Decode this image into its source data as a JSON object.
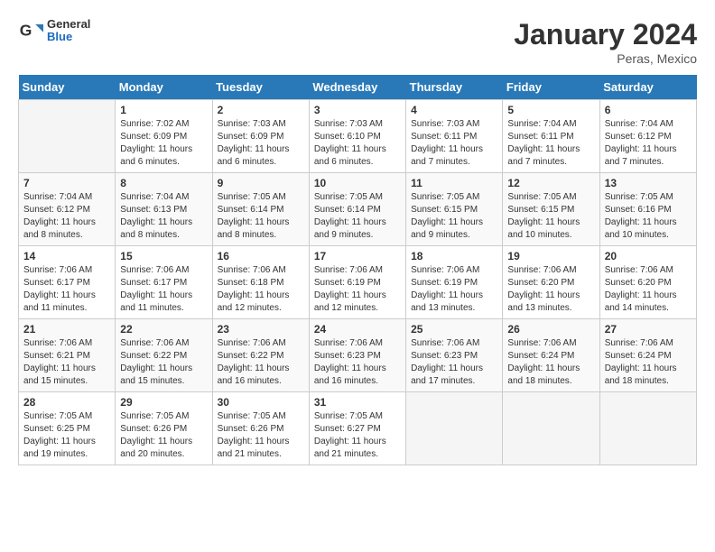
{
  "header": {
    "logo": {
      "general": "General",
      "blue": "Blue"
    },
    "title": "January 2024",
    "location": "Peras, Mexico"
  },
  "weekdays": [
    "Sunday",
    "Monday",
    "Tuesday",
    "Wednesday",
    "Thursday",
    "Friday",
    "Saturday"
  ],
  "weeks": [
    [
      {
        "day": "",
        "empty": true
      },
      {
        "day": "1",
        "sunrise": "Sunrise: 7:02 AM",
        "sunset": "Sunset: 6:09 PM",
        "daylight": "Daylight: 11 hours and 6 minutes."
      },
      {
        "day": "2",
        "sunrise": "Sunrise: 7:03 AM",
        "sunset": "Sunset: 6:09 PM",
        "daylight": "Daylight: 11 hours and 6 minutes."
      },
      {
        "day": "3",
        "sunrise": "Sunrise: 7:03 AM",
        "sunset": "Sunset: 6:10 PM",
        "daylight": "Daylight: 11 hours and 6 minutes."
      },
      {
        "day": "4",
        "sunrise": "Sunrise: 7:03 AM",
        "sunset": "Sunset: 6:11 PM",
        "daylight": "Daylight: 11 hours and 7 minutes."
      },
      {
        "day": "5",
        "sunrise": "Sunrise: 7:04 AM",
        "sunset": "Sunset: 6:11 PM",
        "daylight": "Daylight: 11 hours and 7 minutes."
      },
      {
        "day": "6",
        "sunrise": "Sunrise: 7:04 AM",
        "sunset": "Sunset: 6:12 PM",
        "daylight": "Daylight: 11 hours and 7 minutes."
      }
    ],
    [
      {
        "day": "7",
        "sunrise": "Sunrise: 7:04 AM",
        "sunset": "Sunset: 6:12 PM",
        "daylight": "Daylight: 11 hours and 8 minutes."
      },
      {
        "day": "8",
        "sunrise": "Sunrise: 7:04 AM",
        "sunset": "Sunset: 6:13 PM",
        "daylight": "Daylight: 11 hours and 8 minutes."
      },
      {
        "day": "9",
        "sunrise": "Sunrise: 7:05 AM",
        "sunset": "Sunset: 6:14 PM",
        "daylight": "Daylight: 11 hours and 8 minutes."
      },
      {
        "day": "10",
        "sunrise": "Sunrise: 7:05 AM",
        "sunset": "Sunset: 6:14 PM",
        "daylight": "Daylight: 11 hours and 9 minutes."
      },
      {
        "day": "11",
        "sunrise": "Sunrise: 7:05 AM",
        "sunset": "Sunset: 6:15 PM",
        "daylight": "Daylight: 11 hours and 9 minutes."
      },
      {
        "day": "12",
        "sunrise": "Sunrise: 7:05 AM",
        "sunset": "Sunset: 6:15 PM",
        "daylight": "Daylight: 11 hours and 10 minutes."
      },
      {
        "day": "13",
        "sunrise": "Sunrise: 7:05 AM",
        "sunset": "Sunset: 6:16 PM",
        "daylight": "Daylight: 11 hours and 10 minutes."
      }
    ],
    [
      {
        "day": "14",
        "sunrise": "Sunrise: 7:06 AM",
        "sunset": "Sunset: 6:17 PM",
        "daylight": "Daylight: 11 hours and 11 minutes."
      },
      {
        "day": "15",
        "sunrise": "Sunrise: 7:06 AM",
        "sunset": "Sunset: 6:17 PM",
        "daylight": "Daylight: 11 hours and 11 minutes."
      },
      {
        "day": "16",
        "sunrise": "Sunrise: 7:06 AM",
        "sunset": "Sunset: 6:18 PM",
        "daylight": "Daylight: 11 hours and 12 minutes."
      },
      {
        "day": "17",
        "sunrise": "Sunrise: 7:06 AM",
        "sunset": "Sunset: 6:19 PM",
        "daylight": "Daylight: 11 hours and 12 minutes."
      },
      {
        "day": "18",
        "sunrise": "Sunrise: 7:06 AM",
        "sunset": "Sunset: 6:19 PM",
        "daylight": "Daylight: 11 hours and 13 minutes."
      },
      {
        "day": "19",
        "sunrise": "Sunrise: 7:06 AM",
        "sunset": "Sunset: 6:20 PM",
        "daylight": "Daylight: 11 hours and 13 minutes."
      },
      {
        "day": "20",
        "sunrise": "Sunrise: 7:06 AM",
        "sunset": "Sunset: 6:20 PM",
        "daylight": "Daylight: 11 hours and 14 minutes."
      }
    ],
    [
      {
        "day": "21",
        "sunrise": "Sunrise: 7:06 AM",
        "sunset": "Sunset: 6:21 PM",
        "daylight": "Daylight: 11 hours and 15 minutes."
      },
      {
        "day": "22",
        "sunrise": "Sunrise: 7:06 AM",
        "sunset": "Sunset: 6:22 PM",
        "daylight": "Daylight: 11 hours and 15 minutes."
      },
      {
        "day": "23",
        "sunrise": "Sunrise: 7:06 AM",
        "sunset": "Sunset: 6:22 PM",
        "daylight": "Daylight: 11 hours and 16 minutes."
      },
      {
        "day": "24",
        "sunrise": "Sunrise: 7:06 AM",
        "sunset": "Sunset: 6:23 PM",
        "daylight": "Daylight: 11 hours and 16 minutes."
      },
      {
        "day": "25",
        "sunrise": "Sunrise: 7:06 AM",
        "sunset": "Sunset: 6:23 PM",
        "daylight": "Daylight: 11 hours and 17 minutes."
      },
      {
        "day": "26",
        "sunrise": "Sunrise: 7:06 AM",
        "sunset": "Sunset: 6:24 PM",
        "daylight": "Daylight: 11 hours and 18 minutes."
      },
      {
        "day": "27",
        "sunrise": "Sunrise: 7:06 AM",
        "sunset": "Sunset: 6:24 PM",
        "daylight": "Daylight: 11 hours and 18 minutes."
      }
    ],
    [
      {
        "day": "28",
        "sunrise": "Sunrise: 7:05 AM",
        "sunset": "Sunset: 6:25 PM",
        "daylight": "Daylight: 11 hours and 19 minutes."
      },
      {
        "day": "29",
        "sunrise": "Sunrise: 7:05 AM",
        "sunset": "Sunset: 6:26 PM",
        "daylight": "Daylight: 11 hours and 20 minutes."
      },
      {
        "day": "30",
        "sunrise": "Sunrise: 7:05 AM",
        "sunset": "Sunset: 6:26 PM",
        "daylight": "Daylight: 11 hours and 21 minutes."
      },
      {
        "day": "31",
        "sunrise": "Sunrise: 7:05 AM",
        "sunset": "Sunset: 6:27 PM",
        "daylight": "Daylight: 11 hours and 21 minutes."
      },
      {
        "day": "",
        "empty": true
      },
      {
        "day": "",
        "empty": true
      },
      {
        "day": "",
        "empty": true
      }
    ]
  ]
}
